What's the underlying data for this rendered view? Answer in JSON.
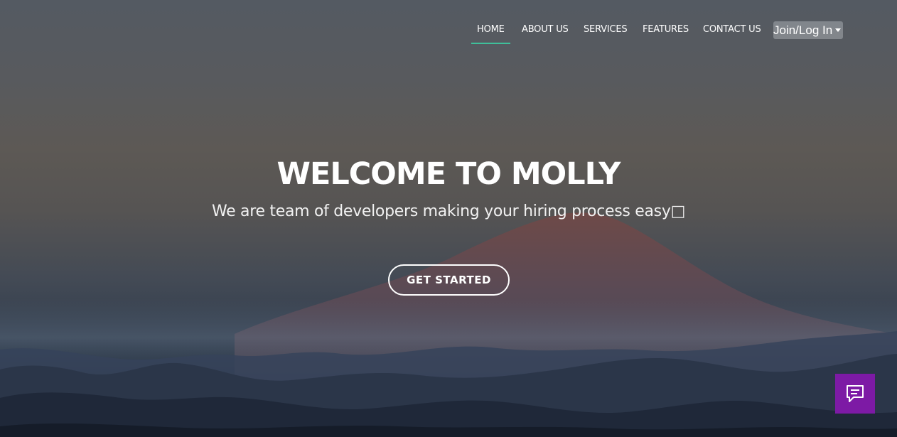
{
  "nav": {
    "items": [
      {
        "label": "HOME",
        "active": true
      },
      {
        "label": "ABOUT US",
        "active": false
      },
      {
        "label": "SERVICES",
        "active": false
      },
      {
        "label": "FEATURES",
        "active": false
      },
      {
        "label": "CONTACT US",
        "active": false
      }
    ],
    "join_label": "Join/Log In",
    "active_color": "#3fbf9a"
  },
  "hero": {
    "title": "WELCOME TO MOLLY",
    "subtitle": "We are team of developers making your hiring process easy□",
    "cta_label": "GET STARTED"
  },
  "chat": {
    "icon": "chat-bubble-icon",
    "color": "#7d1aa5"
  }
}
